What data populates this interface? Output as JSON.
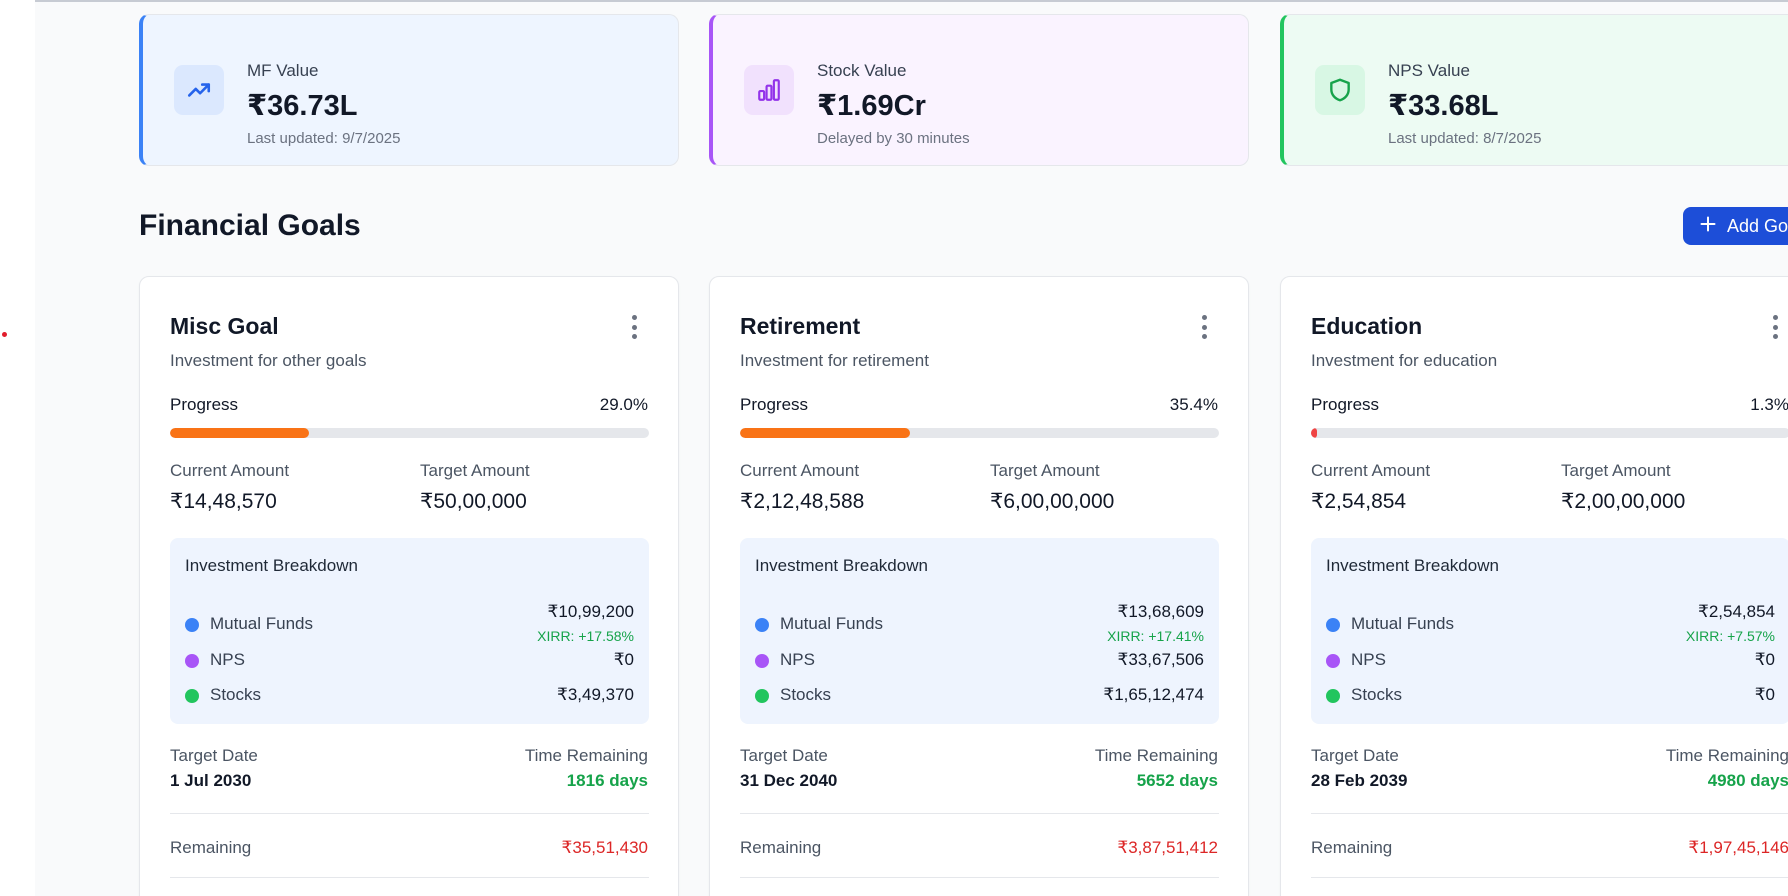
{
  "summary": [
    {
      "label": "MF Value",
      "value": "₹36.73L",
      "sub": "Last updated: 9/7/2025",
      "icon": "trending-up-icon"
    },
    {
      "label": "Stock Value",
      "value": "₹1.69Cr",
      "sub": "Delayed by 30 minutes",
      "icon": "bar-chart-icon"
    },
    {
      "label": "NPS Value",
      "value": "₹33.68L",
      "sub": "Last updated: 8/7/2025",
      "icon": "shield-icon"
    }
  ],
  "section": {
    "title": "Financial Goals",
    "add_goal_label": "Add Goal"
  },
  "labels": {
    "progress": "Progress",
    "current_amount": "Current Amount",
    "target_amount": "Target Amount",
    "breakdown_title": "Investment Breakdown",
    "mutual_funds": "Mutual Funds",
    "nps": "NPS",
    "stocks": "Stocks",
    "target_date": "Target Date",
    "time_remaining": "Time Remaining",
    "remaining": "Remaining"
  },
  "colors": {
    "mutual_funds": "#3b82f6",
    "nps": "#a855f7",
    "stocks": "#22c55e",
    "progress_orange": "#f97316",
    "progress_red": "#ef4444"
  },
  "goals": [
    {
      "title": "Misc Goal",
      "description": "Investment for other goals",
      "progress_text": "29.0%",
      "progress_fraction": 0.29,
      "current": "₹14,48,570",
      "target": "₹50,00,000",
      "mf_value": "₹10,99,200",
      "mf_xirr": "XIRR: +17.58%",
      "nps_value": "₹0",
      "stocks_value": "₹3,49,370",
      "target_date": "1 Jul 2030",
      "time_remaining": "1816 days",
      "remaining": "₹35,51,430"
    },
    {
      "title": "Retirement",
      "description": "Investment for retirement",
      "progress_text": "35.4%",
      "progress_fraction": 0.354,
      "current": "₹2,12,48,588",
      "target": "₹6,00,00,000",
      "mf_value": "₹13,68,609",
      "mf_xirr": "XIRR: +17.41%",
      "nps_value": "₹33,67,506",
      "stocks_value": "₹1,65,12,474",
      "target_date": "31 Dec 2040",
      "time_remaining": "5652 days",
      "remaining": "₹3,87,51,412"
    },
    {
      "title": "Education",
      "description": "Investment for education",
      "progress_text": "1.3%",
      "progress_fraction": 0.013,
      "current": "₹2,54,854",
      "target": "₹2,00,00,000",
      "mf_value": "₹2,54,854",
      "mf_xirr": "XIRR: +7.57%",
      "nps_value": "₹0",
      "stocks_value": "₹0",
      "target_date": "28 Feb 2039",
      "time_remaining": "4980 days",
      "remaining": "₹1,97,45,146"
    }
  ]
}
